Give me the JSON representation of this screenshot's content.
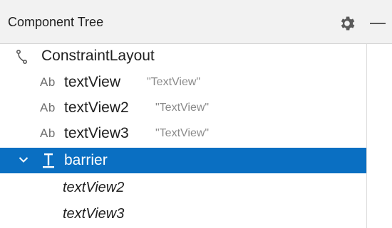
{
  "header": {
    "title": "Component Tree",
    "settings_icon": "gear-icon",
    "minimize_icon": "minimize-icon"
  },
  "tree": {
    "root": {
      "icon": "constraint-layout-icon",
      "label": "ConstraintLayout"
    },
    "views": [
      {
        "icon_text": "Ab",
        "label": "textView",
        "text": "\"TextView\""
      },
      {
        "icon_text": "Ab",
        "label": "textView2",
        "text": "\"TextView\""
      },
      {
        "icon_text": "Ab",
        "label": "textView3",
        "text": "\"TextView\""
      }
    ],
    "barrier": {
      "expand_icon": "chevron-down-icon",
      "icon": "barrier-icon",
      "label": "barrier",
      "selected": true,
      "children": [
        "textView2",
        "textView3"
      ]
    }
  },
  "colors": {
    "selection": "#0a6fc2",
    "header_bg": "#f2f2f2"
  }
}
